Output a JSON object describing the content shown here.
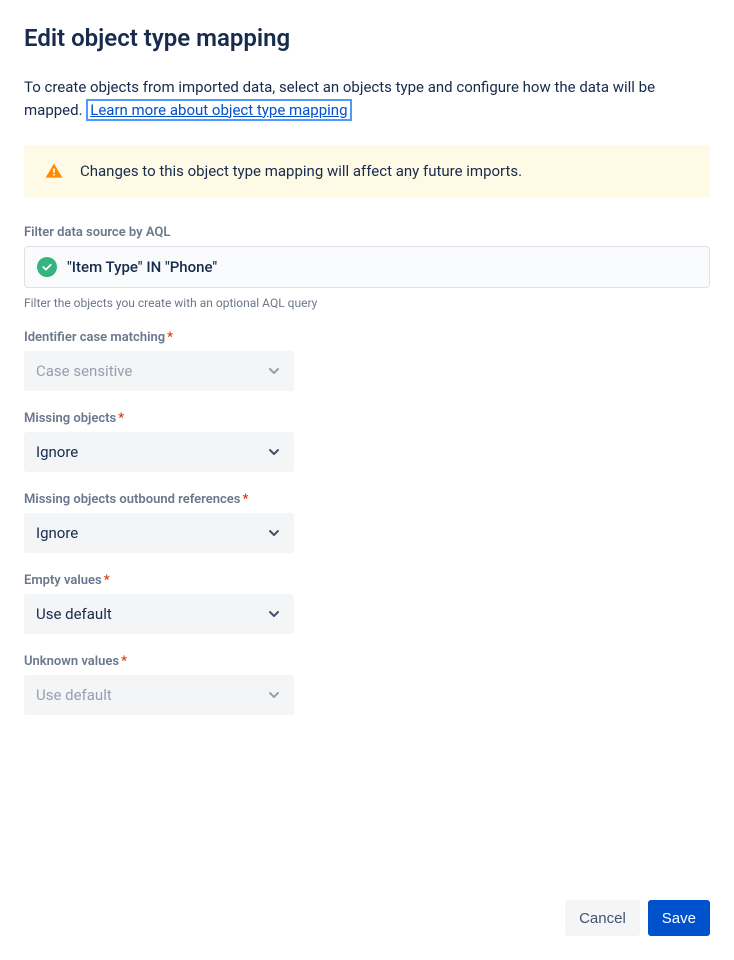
{
  "title": "Edit object type mapping",
  "intro": {
    "text_before_link": "To create objects from imported data, select an objects type and configure how the data will be mapped. ",
    "link_text": "Learn more about object type mapping"
  },
  "warning": {
    "text": "Changes to this object type mapping will affect any future imports."
  },
  "aql": {
    "label": "Filter data source by AQL",
    "value": "\"Item Type\" IN \"Phone\"",
    "hint": "Filter the objects you create with an optional AQL query"
  },
  "fields": {
    "identifier_case": {
      "label": "Identifier case matching",
      "required": true,
      "value": "Case sensitive",
      "disabled": true
    },
    "missing_objects": {
      "label": "Missing objects",
      "required": true,
      "value": "Ignore",
      "disabled": false
    },
    "missing_outbound": {
      "label": "Missing objects outbound references",
      "required": true,
      "value": "Ignore",
      "disabled": false
    },
    "empty_values": {
      "label": "Empty values",
      "required": true,
      "value": "Use default",
      "disabled": false
    },
    "unknown_values": {
      "label": "Unknown values",
      "required": true,
      "value": "Use default",
      "disabled": true
    }
  },
  "footer": {
    "cancel": "Cancel",
    "save": "Save"
  }
}
